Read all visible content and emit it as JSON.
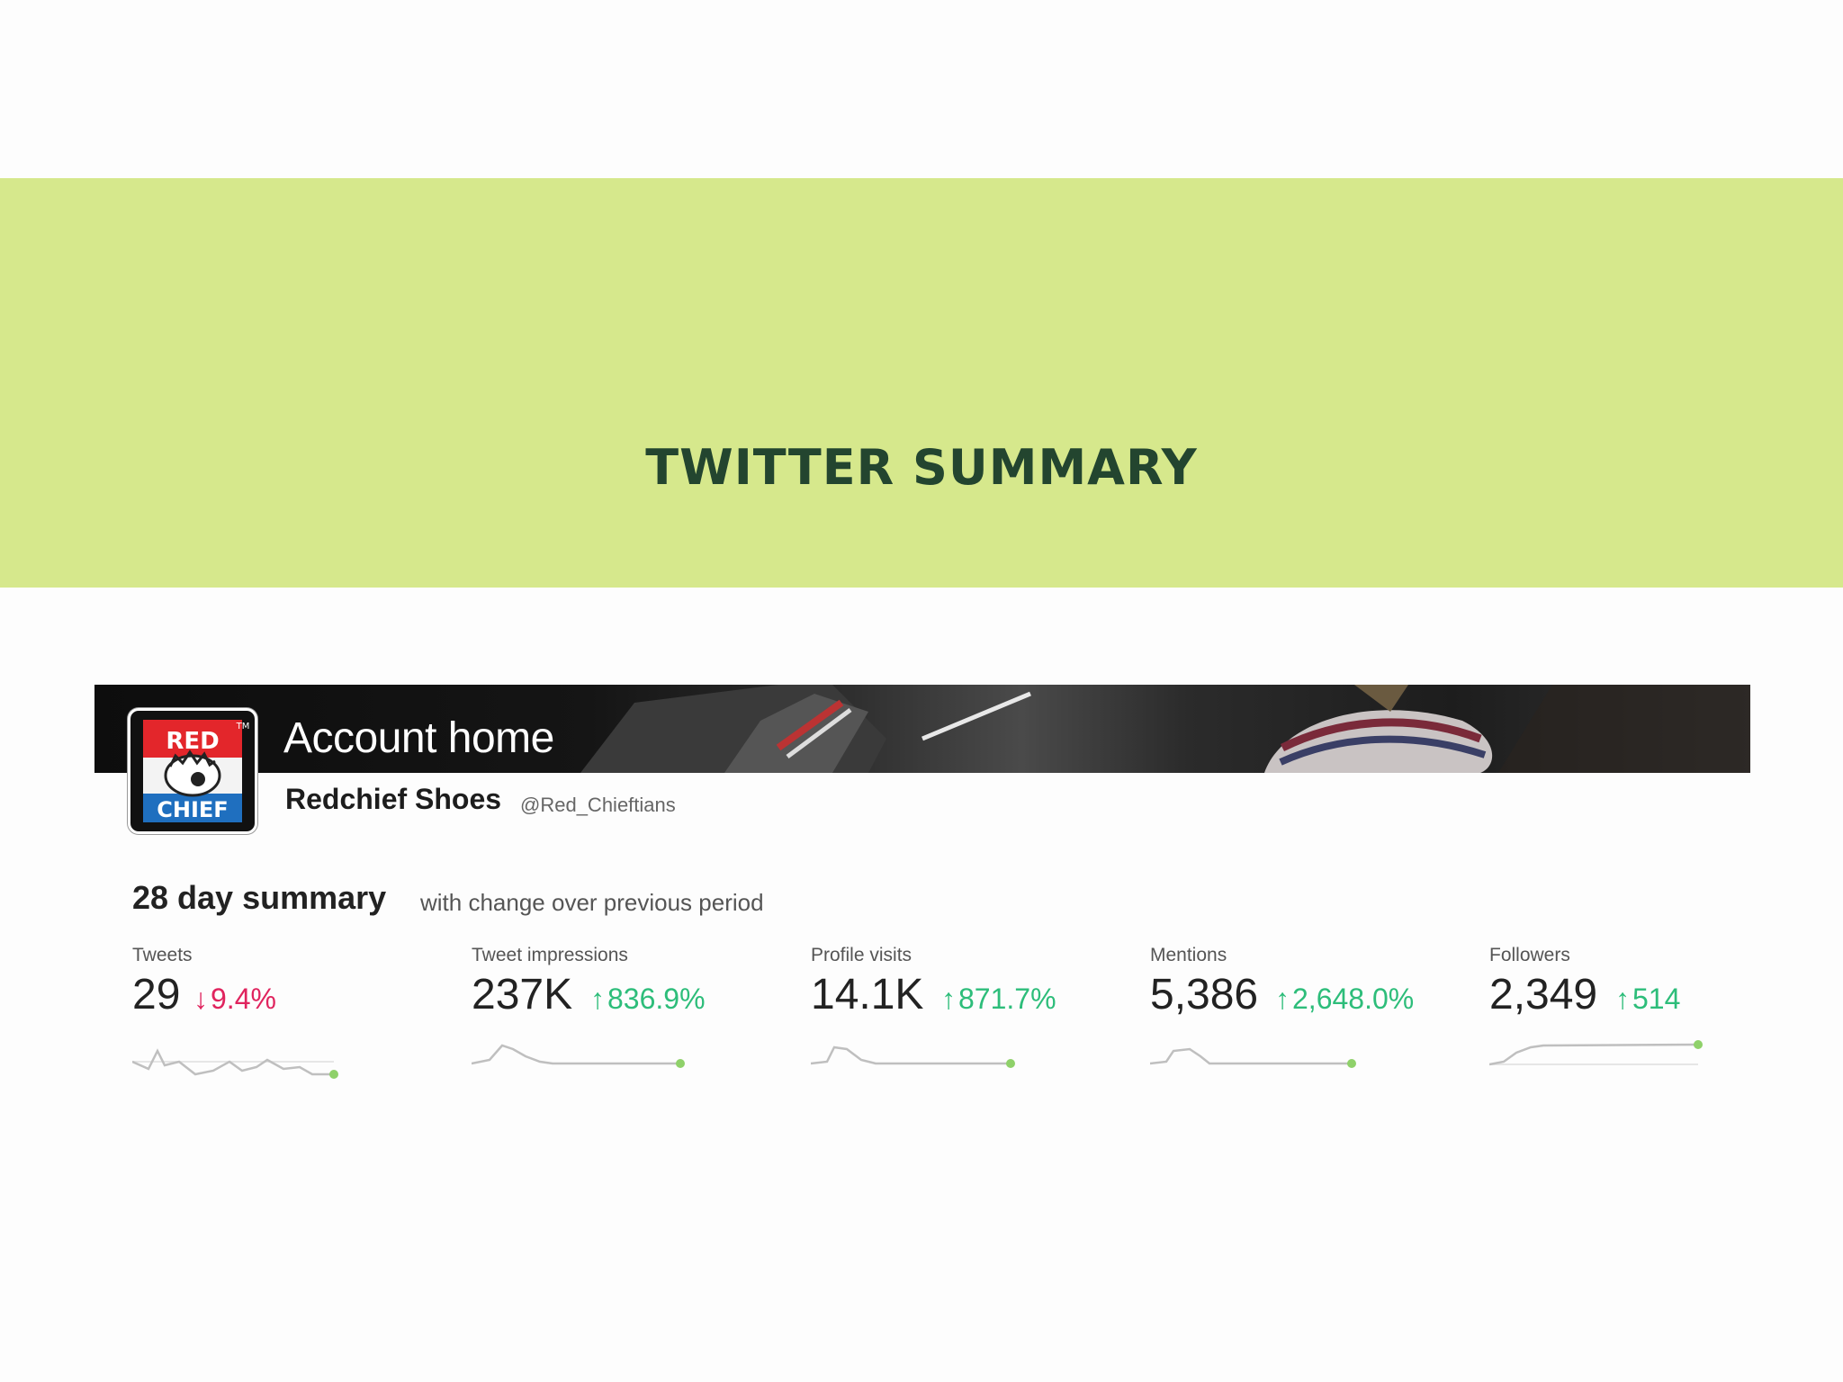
{
  "slide": {
    "title": "TWITTER SUMMARY"
  },
  "account": {
    "header": "Account home",
    "name": "Redchief Shoes",
    "handle": "@Red_Chieftians",
    "logo_text_top": "RED",
    "logo_text_bottom": "CHIEF",
    "logo_tm": "TM"
  },
  "summary": {
    "title": "28 day summary",
    "subtitle": "with change over previous period",
    "stats": [
      {
        "label": "Tweets",
        "value": "29",
        "change": "9.4%",
        "direction": "down"
      },
      {
        "label": "Tweet impressions",
        "value": "237K",
        "change": "836.9%",
        "direction": "up"
      },
      {
        "label": "Profile visits",
        "value": "14.1K",
        "change": "871.7%",
        "direction": "up"
      },
      {
        "label": "Mentions",
        "value": "5,386",
        "change": "2,648.0%",
        "direction": "up"
      },
      {
        "label": "Followers",
        "value": "2,349",
        "change": "514",
        "direction": "up"
      }
    ]
  },
  "colors": {
    "banner": "#d6e88c",
    "title": "#23452f",
    "up": "#2dbd7a",
    "down": "#e0245e",
    "spark_line": "#bfbfbf",
    "spark_dot": "#8fd16a"
  }
}
